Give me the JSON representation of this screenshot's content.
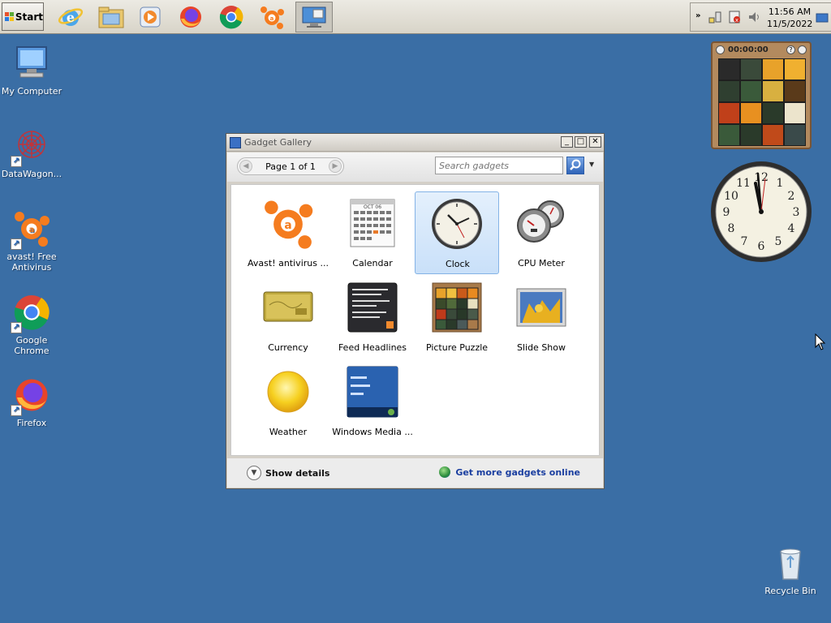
{
  "taskbar": {
    "start_label": "Start",
    "quick_launch": [
      {
        "name": "internet-explorer-icon"
      },
      {
        "name": "windows-explorer-icon"
      },
      {
        "name": "media-player-icon"
      },
      {
        "name": "firefox-icon"
      },
      {
        "name": "chrome-icon"
      },
      {
        "name": "avast-icon"
      },
      {
        "name": "show-desktop-icon"
      }
    ],
    "clock_time": "11:56 AM",
    "clock_date": "11/5/2022"
  },
  "desktop_icons": [
    {
      "label": "My Computer",
      "icon": "my-computer-icon"
    },
    {
      "label": "DataWagon...",
      "icon": "datawagon-icon"
    },
    {
      "label": "avast! Free Antivirus",
      "icon": "avast-icon"
    },
    {
      "label": "Google Chrome",
      "icon": "chrome-icon"
    },
    {
      "label": "Firefox",
      "icon": "firefox-icon"
    },
    {
      "label": "Recycle Bin",
      "icon": "recycle-bin-icon"
    }
  ],
  "window": {
    "title": "Gadget Gallery",
    "page_label": "Page 1 of 1",
    "search_placeholder": "Search gadgets",
    "gadgets": [
      {
        "label": "Avast! antivirus ...",
        "icon": "avast-icon"
      },
      {
        "label": "Calendar",
        "icon": "calendar-icon"
      },
      {
        "label": "Clock",
        "icon": "clock-icon",
        "selected": true
      },
      {
        "label": "CPU Meter",
        "icon": "cpu-meter-icon"
      },
      {
        "label": "Currency",
        "icon": "currency-icon"
      },
      {
        "label": "Feed Headlines",
        "icon": "feed-headlines-icon"
      },
      {
        "label": "Picture Puzzle",
        "icon": "picture-puzzle-icon"
      },
      {
        "label": "Slide Show",
        "icon": "slide-show-icon"
      },
      {
        "label": "Weather",
        "icon": "weather-icon"
      },
      {
        "label": "Windows Media ...",
        "icon": "windows-media-icon"
      }
    ],
    "calendar_month": "OCT 06",
    "show_details_label": "Show details",
    "get_more_label": "Get more gadgets online"
  },
  "desktop_gadgets": {
    "puzzle_timer": "00:00:00"
  },
  "colors": {
    "desktop": "#3a6ea5",
    "selection": "#c9e0f9",
    "link": "#1b3fa0"
  }
}
